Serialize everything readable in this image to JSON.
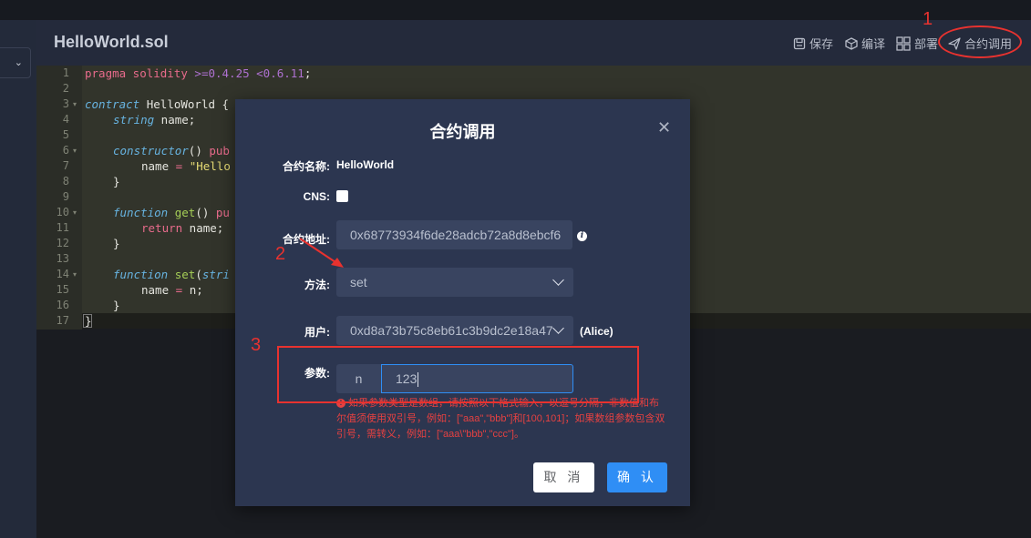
{
  "header": {
    "file_title": "HelloWorld.sol",
    "toolbar": {
      "save_label": "保存",
      "compile_label": "编译",
      "deploy_label": "部署",
      "call_label": "合约调用"
    }
  },
  "editor": {
    "line_numbers": [
      "1",
      "2",
      "3",
      "4",
      "5",
      "6",
      "7",
      "8",
      "9",
      "10",
      "11",
      "12",
      "13",
      "14",
      "15",
      "16",
      "17"
    ],
    "lines": {
      "l1": {
        "kw": "pragma solidity",
        "op": ">=0.4.25 <0.6.11",
        "pl": ";"
      },
      "l3": {
        "kw": "contract",
        "pl": " HelloWorld {"
      },
      "l4": {
        "ty": "string",
        "pl": " name;"
      },
      "l6": {
        "it": "constructor",
        "pl": "() ",
        "kw": "pub"
      },
      "l7": {
        "pl": "name ",
        "op": "=",
        "st": " \"Hello"
      },
      "l8": "}",
      "l10": {
        "it": "function",
        "fn": " get",
        "pl": "() ",
        "kw": "pu"
      },
      "l11": {
        "kw": "return",
        "pl": " name;"
      },
      "l12": "}",
      "l14": {
        "it": "function",
        "fn": " set",
        "pl": "(",
        "ty": "stri"
      },
      "l15": {
        "pl1": "name ",
        "op": "=",
        "pl2": " n;"
      },
      "l16": "}",
      "l17": "}"
    }
  },
  "dialog": {
    "title": "合约调用",
    "contract_name_label": "合约名称:",
    "contract_name_value": "HelloWorld",
    "cns_label": "CNS:",
    "address_label": "合约地址:",
    "address_value": "0x68773934f6de28adcb72a8d8ebcf6",
    "method_label": "方法:",
    "method_value": "set",
    "user_label": "用户:",
    "user_value": "0xd8a73b75c8eb61c3b9dc2e18a47",
    "user_alias": "(Alice)",
    "params_label": "参数:",
    "param_name": "n",
    "param_value": "123",
    "hint": "如果参数类型是数组，请按照以下格式输入，以逗号分隔，非数值和布尔值须使用双引号，例如：[\"aaa\",\"bbb\"]和[100,101]；如果数组参数包含双引号，需转义，例如：[\"aaa\\\"bbb\",\"ccc\"]。",
    "cancel_label": "取 消",
    "confirm_label": "确 认"
  },
  "annotations": {
    "step1": "1",
    "step2": "2",
    "step3": "3"
  },
  "colors": {
    "annotation": "#e8322f",
    "primary": "#2f8ef5",
    "dialog_bg": "#2c3650",
    "field_bg": "#394460",
    "hint": "#e64141"
  }
}
